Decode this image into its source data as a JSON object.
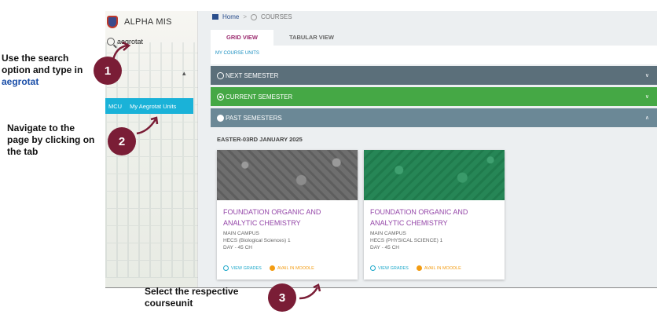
{
  "app": {
    "name": "ALPHA MIS",
    "search_value": "aegrotat",
    "menu_code": "MCU",
    "menu_label": "My Aegrotat Units"
  },
  "breadcrumb": {
    "home": "Home",
    "separator": ">",
    "current": "COURSES"
  },
  "tabs": [
    "GRID VIEW",
    "TABULAR VIEW"
  ],
  "my_course_units": "MY COURSE UNITS",
  "semesters": {
    "next": "NEXT SEMESTER",
    "current": "CURRENT SEMESTER",
    "past": "PAST SEMESTERS"
  },
  "semester_title": "EASTER-03RD JANUARY 2025",
  "cards": [
    {
      "title": "FOUNDATION ORGANIC AND ANALYTIC CHEMISTRY",
      "campus": "MAIN CAMPUS",
      "program": "HECS (Biological Sciences) 1",
      "session": "DAY - 45 CH",
      "view_grades": "VIEW GRADES",
      "avail_moodle": "AVAIL IN MOODLE"
    },
    {
      "title": "FOUNDATION ORGANIC AND ANALYTIC CHEMISTRY",
      "campus": "MAIN CAMPUS",
      "program": "HECS (PHYSICAL SCIENCE) 1",
      "session": "DAY - 45 CH",
      "view_grades": "VIEW GRADES",
      "avail_moodle": "AVAIL IN MOODLE"
    }
  ],
  "annotations": {
    "step1": {
      "number": "1",
      "line1": "Use the search",
      "line2": "option and type in",
      "keyword": "aegrotat"
    },
    "step2": {
      "number": "2",
      "line1": "Navigate to the",
      "line2": "page by clicking on",
      "line3": "the tab"
    },
    "step3": {
      "number": "3",
      "line1": "Select the respective",
      "line2": "courseunit"
    }
  },
  "colors": {
    "accent_teal": "#1ab2d8",
    "next_semester": "#5b6f7a",
    "current_semester": "#45a845",
    "past_semester": "#6b8896",
    "card_title": "#9446a8",
    "badge": "#7a1d36",
    "highlight": "#1a4ea8"
  }
}
